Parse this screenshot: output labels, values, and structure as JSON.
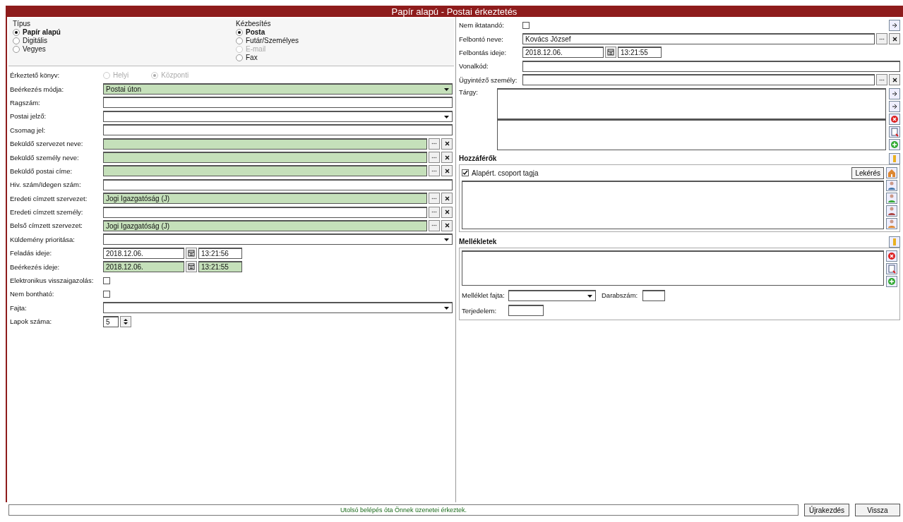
{
  "window": {
    "title": "Papír alapú - Postai érkeztetés"
  },
  "left": {
    "groups": [
      {
        "title": "Típus",
        "options": [
          {
            "label": "Papír alapú",
            "selected": true,
            "disabled": false
          },
          {
            "label": "Digitális",
            "selected": false,
            "disabled": false
          },
          {
            "label": "Vegyes",
            "selected": false,
            "disabled": false
          }
        ]
      },
      {
        "title": "Kézbesítés",
        "options": [
          {
            "label": "Posta",
            "selected": true,
            "disabled": false
          },
          {
            "label": "Futár/Személyes",
            "selected": false,
            "disabled": false
          },
          {
            "label": "E-mail",
            "selected": false,
            "disabled": true
          },
          {
            "label": "Fax",
            "selected": false,
            "disabled": false
          }
        ]
      }
    ],
    "fields": [
      {
        "kind": "radios",
        "label": "Érkeztető könyv:",
        "options": [
          {
            "label": "Helyi",
            "selected": false,
            "disabled": true
          },
          {
            "label": "Központi",
            "selected": true,
            "disabled": true
          }
        ]
      },
      {
        "kind": "combo",
        "label": "Beérkezés módja:",
        "value": "Postai úton",
        "required": true
      },
      {
        "kind": "text",
        "label": "Ragszám:",
        "required": false
      },
      {
        "kind": "combo",
        "label": "Postai jelző:",
        "required": false
      },
      {
        "kind": "text",
        "label": "Csomag jel:",
        "required": false
      },
      {
        "kind": "lookup",
        "label": "Beküldő szervezet neve:",
        "required": true
      },
      {
        "kind": "lookup",
        "label": "Beküldő személy neve:",
        "required": true
      },
      {
        "kind": "lookup",
        "label": "Beküldő postai címe:",
        "required": true
      },
      {
        "kind": "text",
        "label": "Hiv. szám/Idegen szám:",
        "required": false
      },
      {
        "kind": "lookup",
        "label": "Eredeti címzett szervezet:",
        "value": "Jogi Igazgatóság (J)",
        "required": true
      },
      {
        "kind": "lookup",
        "label": "Eredeti címzett személy:",
        "required": false
      },
      {
        "kind": "lookup",
        "label": "Belső címzett szervezet:",
        "value": "Jogi Igazgatóság (J)",
        "required": true
      },
      {
        "kind": "combo",
        "label": "Küldemény prioritása:",
        "required": false
      },
      {
        "kind": "datetime",
        "label": "Feladás ideje:",
        "date": "2018.12.06.",
        "time": "13:21:56",
        "required": false
      },
      {
        "kind": "datetime",
        "label": "Beérkezés ideje:",
        "date": "2018.12.06.",
        "time": "13:21:55",
        "required": true
      },
      {
        "kind": "checkbox",
        "label": "Elektronikus visszaigazolás:",
        "checked": false
      },
      {
        "kind": "checkbox",
        "label": "Nem bontható:",
        "checked": false
      },
      {
        "kind": "combo",
        "label": "Fajta:",
        "required": false
      },
      {
        "kind": "spinner",
        "label": "Lapok száma:",
        "value": "5"
      }
    ]
  },
  "right": {
    "fields": [
      {
        "kind": "checkbox",
        "label": "Nem iktatandó:",
        "checked": false
      },
      {
        "kind": "lookup",
        "label": "Felbontó neve:",
        "value": "Kovács József",
        "required": false
      },
      {
        "kind": "datetime",
        "label": "Felbontás ideje:",
        "date": "2018.12.06.",
        "time": "13:21:55",
        "required": false
      },
      {
        "kind": "text",
        "label": "Vonalkód:",
        "required": false
      },
      {
        "kind": "lookup",
        "label": "Ügyintéző személy:",
        "required": false
      }
    ],
    "subject_label": "Tárgy:",
    "access": {
      "title": "Hozzáférők",
      "checkbox_label": "Alapért. csoport tagja",
      "checked": true,
      "button": "Lekérés"
    },
    "attachments": {
      "title": "Mellékletek",
      "type_label": "Melléklet fajta:",
      "count_label": "Darabszám:",
      "size_label": "Terjedelem:"
    }
  },
  "status_bar": {
    "message": "Utolsó belépés óta Önnek üzenetei érkeztek.",
    "buttons": [
      "Újrakezdés",
      "Vissza"
    ]
  }
}
